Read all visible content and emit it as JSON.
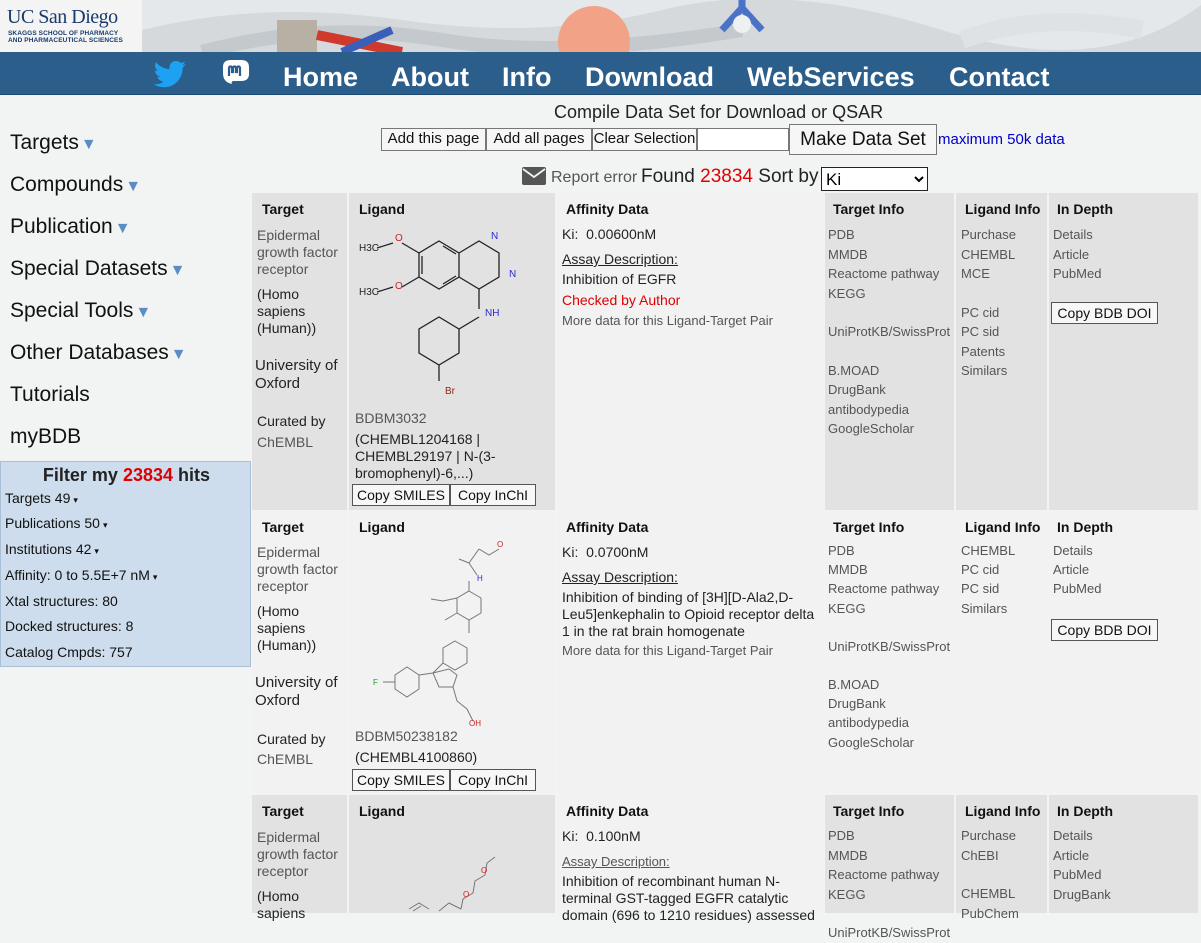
{
  "banner": {
    "university": "UC San Diego",
    "school_line1": "SKAGGS SCHOOL OF PHARMACY",
    "school_line2": "AND PHARMACEUTICAL SCIENCES"
  },
  "nav": {
    "links": [
      "Home",
      "About",
      "Info",
      "Download",
      "WebServices",
      "Contact"
    ],
    "icons": [
      "twitter-icon",
      "mastodon-icon"
    ],
    "twitter_color": "#1da1f2"
  },
  "sidebar": {
    "items": [
      {
        "label": "Targets",
        "caret": "▼"
      },
      {
        "label": "Compounds",
        "caret": "▼"
      },
      {
        "label": "Publication",
        "caret": "▼"
      },
      {
        "label": "Special Datasets",
        "caret": "▼"
      },
      {
        "label": "Special Tools",
        "caret": "▼"
      },
      {
        "label": "Other Databases",
        "caret": "▼"
      },
      {
        "label": "Tutorials",
        "caret": ""
      },
      {
        "label": "myBDB",
        "caret": ""
      }
    ],
    "filter": {
      "title_prefix": "Filter my",
      "count": "23834",
      "title_suffix": "hits",
      "rows": [
        {
          "label": "Targets 49",
          "tri": "▾"
        },
        {
          "label": "Publications 50",
          "tri": "▾"
        },
        {
          "label": "Institutions 42",
          "tri": "▾"
        },
        {
          "label": "Affinity: 0 to 5.5E+7 nM",
          "tri": "▾"
        },
        {
          "label": "Xtal structures: 80",
          "tri": ""
        },
        {
          "label": "Docked structures: 8",
          "tri": ""
        },
        {
          "label": "Catalog Cmpds: 757",
          "tri": ""
        }
      ]
    }
  },
  "compile": {
    "title": "Compile Data Set for Download or QSAR",
    "add_page": "Add this page",
    "add_all": "Add all pages",
    "clear": "Clear Selection",
    "input_value": "",
    "make": "Make Data Set",
    "max": "maximum 50k data"
  },
  "results_bar": {
    "report_error": "Report error",
    "found_label": "Found",
    "found_count": "23834",
    "sort_label": "Sort by",
    "sort_value": "Ki"
  },
  "headers": {
    "target": "Target",
    "ligand": "Ligand",
    "affinity": "Affinity Data",
    "target_info": "Target Info",
    "ligand_info": "Ligand Info",
    "in_depth": "In Depth"
  },
  "results": [
    {
      "target_name": [
        "Epidermal",
        "growth factor",
        "receptor"
      ],
      "organism": [
        "(Homo",
        "sapiens",
        "(Human))"
      ],
      "institution": [
        "University of",
        "Oxford"
      ],
      "curated_by": "Curated by",
      "curator": "ChEMBL",
      "bdbm": "BDBM3032",
      "ligand_ids": [
        "(CHEMBL1204168 |",
        "CHEMBL29197 | N-(3-",
        "bromophenyl)-6,...)"
      ],
      "copy_smiles": "Copy SMILES",
      "copy_inchi": "Copy InChI",
      "affinity": "Ki:  0.00600nM",
      "assay_label": "Assay Description:",
      "assay_text": [
        "Inhibition of EGFR"
      ],
      "checked": "Checked by Author",
      "more": "More data for this Ligand-Target Pair",
      "target_info": [
        "PDB",
        "MMDB",
        "Reactome pathway",
        "KEGG",
        "",
        "UniProtKB/SwissProt",
        "",
        "B.MOAD",
        "DrugBank",
        "antibodypedia",
        "GoogleScholar"
      ],
      "ligand_info": [
        "Purchase",
        "CHEMBL",
        "MCE",
        "",
        "PC cid",
        "PC sid",
        "Patents",
        "Similars"
      ],
      "in_depth": [
        "Details",
        "Article",
        "PubMed"
      ],
      "copy_doi": "Copy BDB DOI",
      "mol_labels": {
        "h3c1": "H3C",
        "h3c2": "H3C",
        "o1": "O",
        "o2": "O",
        "n1": "N",
        "n2": "N",
        "nh": "NH",
        "br": "Br"
      }
    },
    {
      "target_name": [
        "Epidermal",
        "growth factor",
        "receptor"
      ],
      "organism": [
        "(Homo",
        "sapiens",
        "(Human))"
      ],
      "institution": [
        "University of",
        "Oxford"
      ],
      "curated_by": "Curated by",
      "curator": "ChEMBL",
      "bdbm": "BDBM50238182",
      "ligand_ids": [
        "(CHEMBL4100860)"
      ],
      "copy_smiles": "Copy SMILES",
      "copy_inchi": "Copy InChI",
      "affinity": "Ki:  0.0700nM",
      "assay_label": "Assay Description:",
      "assay_text": [
        "Inhibition of binding of [3H][D-Ala2,D-",
        "Leu5]enkephalin to Opioid receptor delta",
        "1 in the rat brain homogenate"
      ],
      "checked": "",
      "more": "More data for this Ligand-Target Pair",
      "target_info": [
        "PDB",
        "MMDB",
        "Reactome pathway",
        "KEGG",
        "",
        "UniProtKB/SwissProt",
        "",
        "B.MOAD",
        "DrugBank",
        "antibodypedia",
        "GoogleScholar"
      ],
      "ligand_info": [
        "CHEMBL",
        "PC cid",
        "PC sid",
        "Similars"
      ],
      "in_depth": [
        "Details",
        "Article",
        "PubMed"
      ],
      "copy_doi": "Copy BDB DOI"
    },
    {
      "target_name": [
        "Epidermal",
        "growth factor",
        "receptor"
      ],
      "organism": [
        "(Homo",
        "sapiens"
      ],
      "affinity": "Ki:  0.100nM",
      "assay_label": "Assay Description:",
      "assay_text": [
        "Inhibition of recombinant human N-",
        "terminal GST-tagged EGFR catalytic",
        "domain (696 to 1210 residues) assessed"
      ],
      "target_info": [
        "PDB",
        "MMDB",
        "Reactome pathway",
        "KEGG",
        "",
        "UniProtKB/SwissProt"
      ],
      "ligand_info": [
        "Purchase",
        "ChEBI",
        "",
        "CHEMBL",
        "PubChem"
      ],
      "in_depth": [
        "Details",
        "Article",
        "PubMed",
        "DrugBank"
      ]
    }
  ]
}
